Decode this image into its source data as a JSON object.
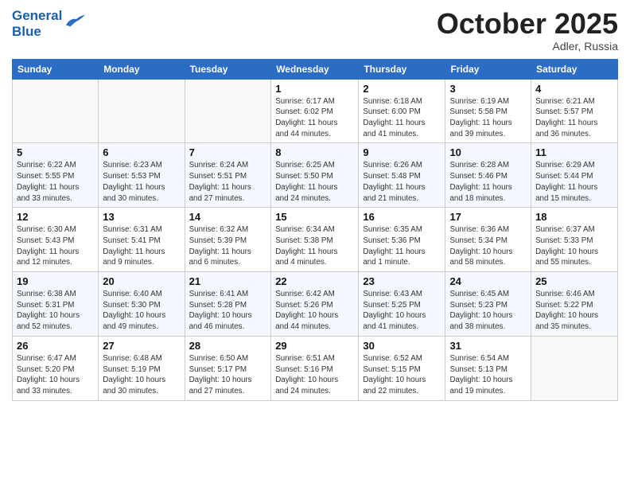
{
  "header": {
    "logo_line1": "General",
    "logo_line2": "Blue",
    "month_title": "October 2025",
    "location": "Adler, Russia"
  },
  "days_of_week": [
    "Sunday",
    "Monday",
    "Tuesday",
    "Wednesday",
    "Thursday",
    "Friday",
    "Saturday"
  ],
  "weeks": [
    [
      {
        "day": "",
        "info": ""
      },
      {
        "day": "",
        "info": ""
      },
      {
        "day": "",
        "info": ""
      },
      {
        "day": "1",
        "info": "Sunrise: 6:17 AM\nSunset: 6:02 PM\nDaylight: 11 hours\nand 44 minutes."
      },
      {
        "day": "2",
        "info": "Sunrise: 6:18 AM\nSunset: 6:00 PM\nDaylight: 11 hours\nand 41 minutes."
      },
      {
        "day": "3",
        "info": "Sunrise: 6:19 AM\nSunset: 5:58 PM\nDaylight: 11 hours\nand 39 minutes."
      },
      {
        "day": "4",
        "info": "Sunrise: 6:21 AM\nSunset: 5:57 PM\nDaylight: 11 hours\nand 36 minutes."
      }
    ],
    [
      {
        "day": "5",
        "info": "Sunrise: 6:22 AM\nSunset: 5:55 PM\nDaylight: 11 hours\nand 33 minutes."
      },
      {
        "day": "6",
        "info": "Sunrise: 6:23 AM\nSunset: 5:53 PM\nDaylight: 11 hours\nand 30 minutes."
      },
      {
        "day": "7",
        "info": "Sunrise: 6:24 AM\nSunset: 5:51 PM\nDaylight: 11 hours\nand 27 minutes."
      },
      {
        "day": "8",
        "info": "Sunrise: 6:25 AM\nSunset: 5:50 PM\nDaylight: 11 hours\nand 24 minutes."
      },
      {
        "day": "9",
        "info": "Sunrise: 6:26 AM\nSunset: 5:48 PM\nDaylight: 11 hours\nand 21 minutes."
      },
      {
        "day": "10",
        "info": "Sunrise: 6:28 AM\nSunset: 5:46 PM\nDaylight: 11 hours\nand 18 minutes."
      },
      {
        "day": "11",
        "info": "Sunrise: 6:29 AM\nSunset: 5:44 PM\nDaylight: 11 hours\nand 15 minutes."
      }
    ],
    [
      {
        "day": "12",
        "info": "Sunrise: 6:30 AM\nSunset: 5:43 PM\nDaylight: 11 hours\nand 12 minutes."
      },
      {
        "day": "13",
        "info": "Sunrise: 6:31 AM\nSunset: 5:41 PM\nDaylight: 11 hours\nand 9 minutes."
      },
      {
        "day": "14",
        "info": "Sunrise: 6:32 AM\nSunset: 5:39 PM\nDaylight: 11 hours\nand 6 minutes."
      },
      {
        "day": "15",
        "info": "Sunrise: 6:34 AM\nSunset: 5:38 PM\nDaylight: 11 hours\nand 4 minutes."
      },
      {
        "day": "16",
        "info": "Sunrise: 6:35 AM\nSunset: 5:36 PM\nDaylight: 11 hours\nand 1 minute."
      },
      {
        "day": "17",
        "info": "Sunrise: 6:36 AM\nSunset: 5:34 PM\nDaylight: 10 hours\nand 58 minutes."
      },
      {
        "day": "18",
        "info": "Sunrise: 6:37 AM\nSunset: 5:33 PM\nDaylight: 10 hours\nand 55 minutes."
      }
    ],
    [
      {
        "day": "19",
        "info": "Sunrise: 6:38 AM\nSunset: 5:31 PM\nDaylight: 10 hours\nand 52 minutes."
      },
      {
        "day": "20",
        "info": "Sunrise: 6:40 AM\nSunset: 5:30 PM\nDaylight: 10 hours\nand 49 minutes."
      },
      {
        "day": "21",
        "info": "Sunrise: 6:41 AM\nSunset: 5:28 PM\nDaylight: 10 hours\nand 46 minutes."
      },
      {
        "day": "22",
        "info": "Sunrise: 6:42 AM\nSunset: 5:26 PM\nDaylight: 10 hours\nand 44 minutes."
      },
      {
        "day": "23",
        "info": "Sunrise: 6:43 AM\nSunset: 5:25 PM\nDaylight: 10 hours\nand 41 minutes."
      },
      {
        "day": "24",
        "info": "Sunrise: 6:45 AM\nSunset: 5:23 PM\nDaylight: 10 hours\nand 38 minutes."
      },
      {
        "day": "25",
        "info": "Sunrise: 6:46 AM\nSunset: 5:22 PM\nDaylight: 10 hours\nand 35 minutes."
      }
    ],
    [
      {
        "day": "26",
        "info": "Sunrise: 6:47 AM\nSunset: 5:20 PM\nDaylight: 10 hours\nand 33 minutes."
      },
      {
        "day": "27",
        "info": "Sunrise: 6:48 AM\nSunset: 5:19 PM\nDaylight: 10 hours\nand 30 minutes."
      },
      {
        "day": "28",
        "info": "Sunrise: 6:50 AM\nSunset: 5:17 PM\nDaylight: 10 hours\nand 27 minutes."
      },
      {
        "day": "29",
        "info": "Sunrise: 6:51 AM\nSunset: 5:16 PM\nDaylight: 10 hours\nand 24 minutes."
      },
      {
        "day": "30",
        "info": "Sunrise: 6:52 AM\nSunset: 5:15 PM\nDaylight: 10 hours\nand 22 minutes."
      },
      {
        "day": "31",
        "info": "Sunrise: 6:54 AM\nSunset: 5:13 PM\nDaylight: 10 hours\nand 19 minutes."
      },
      {
        "day": "",
        "info": ""
      }
    ]
  ]
}
